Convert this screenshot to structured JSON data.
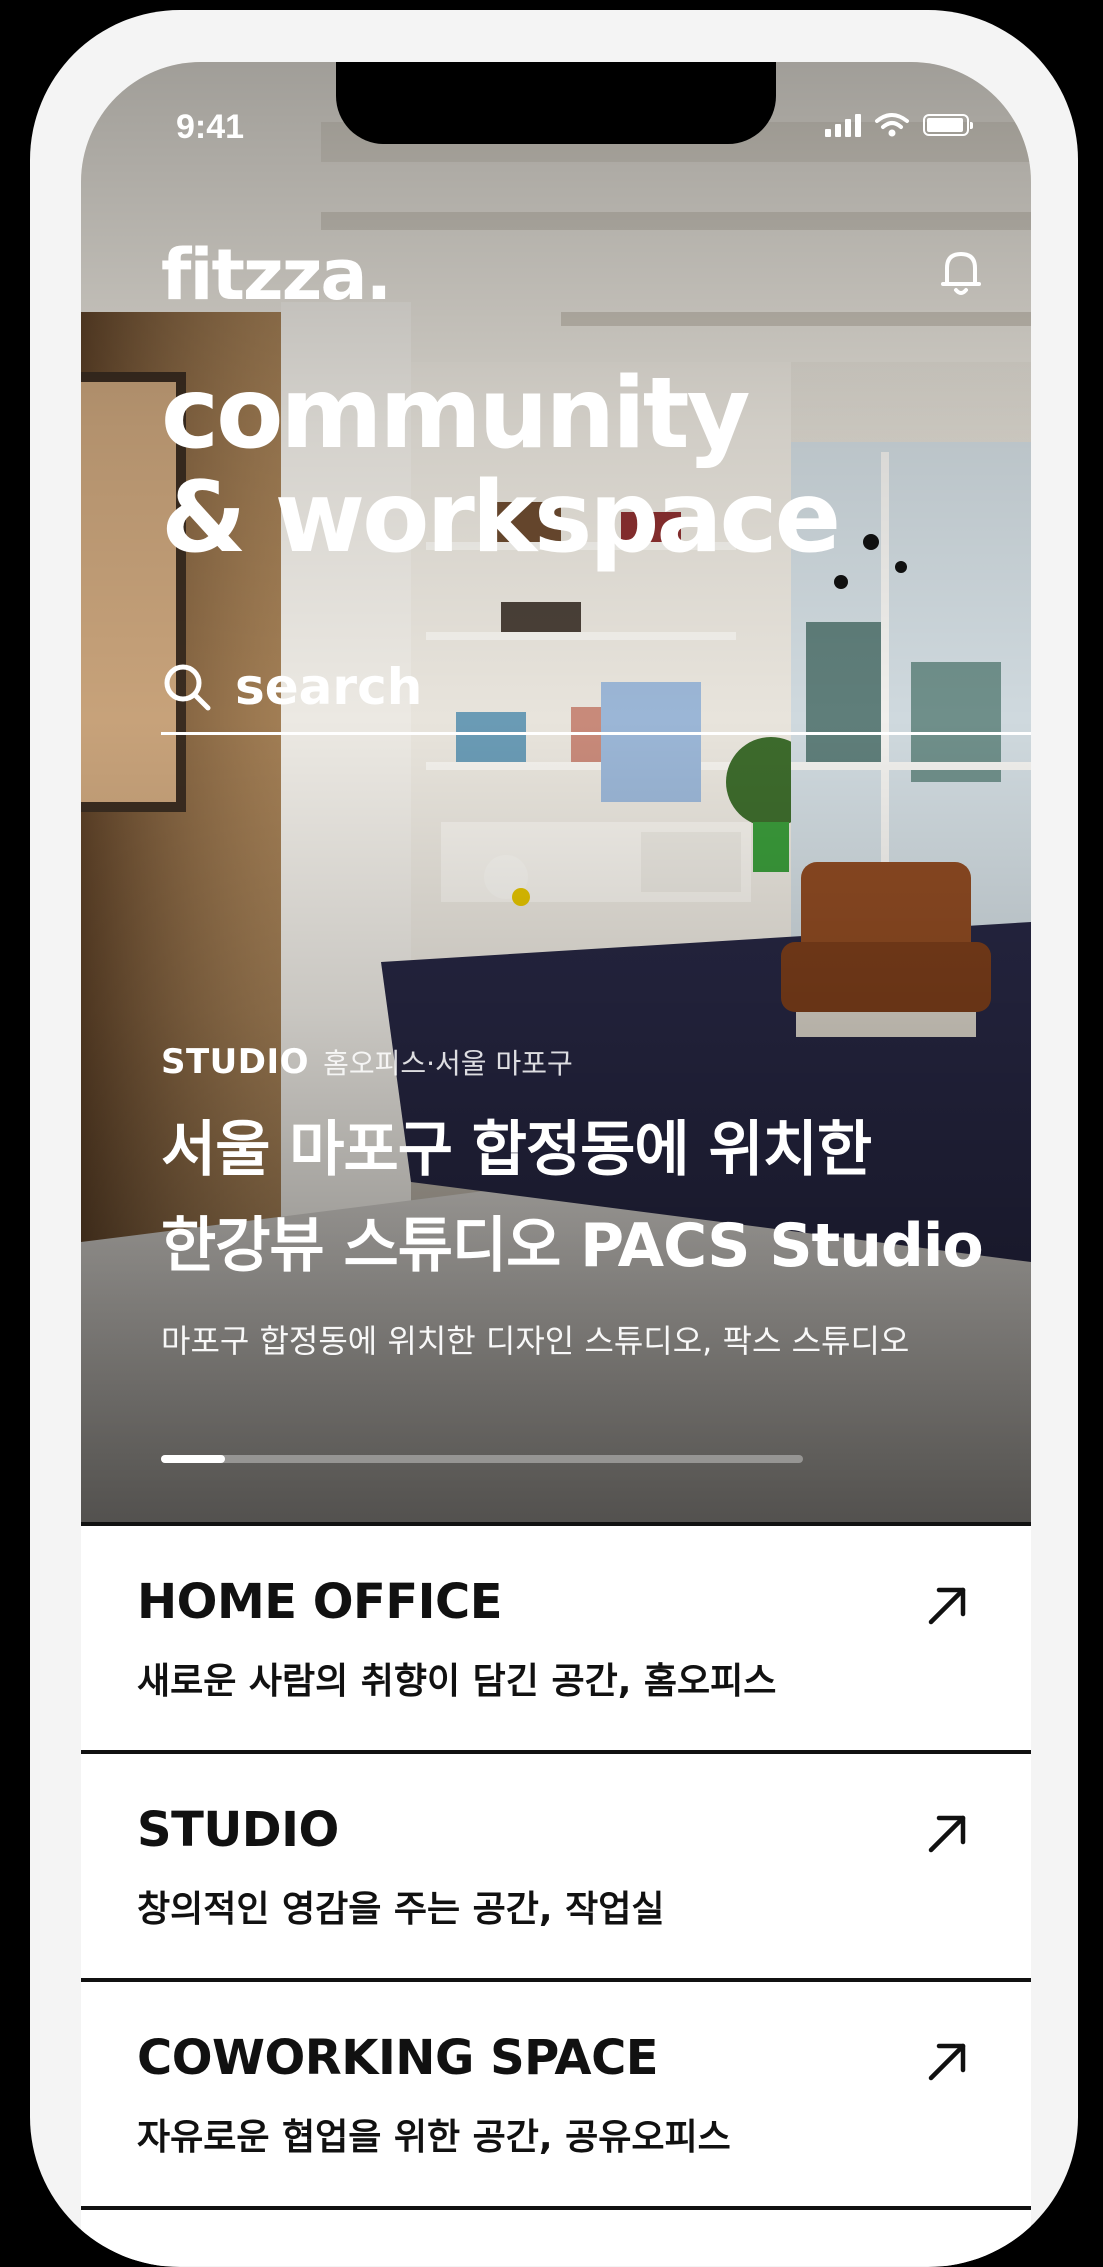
{
  "status_bar": {
    "time": "9:41"
  },
  "brand": {
    "logo": "fitzza."
  },
  "hero": {
    "headline_line1": "community",
    "headline_line2": "& workspace",
    "search_placeholder": "search",
    "featured": {
      "category": "STUDIO",
      "subcategory": "홈오피스·서울 마포구",
      "title_line1": "서울 마포구 합정동에 위치한",
      "title_line2": "한강뷰 스튜디오 PACS Studio",
      "description": "마포구 합정동에 위치한 디자인 스튜디오, 팍스 스튜디오"
    },
    "carousel_progress": 0.1
  },
  "categories": [
    {
      "name": "HOME OFFICE",
      "tagline": "새로운 사람의 취향이 담긴 공간, 홈오피스",
      "icon": "arrow-up-right-icon"
    },
    {
      "name": "STUDIO",
      "tagline": "창의적인 영감을 주는 공간, 작업실",
      "icon": "arrow-up-right-icon"
    },
    {
      "name": "COWORKING SPACE",
      "tagline": "자유로운 협업을 위한 공간, 공유오피스",
      "icon": "arrow-up-right-icon"
    }
  ],
  "icons": {
    "notification": "bell-icon",
    "search": "search-icon"
  }
}
